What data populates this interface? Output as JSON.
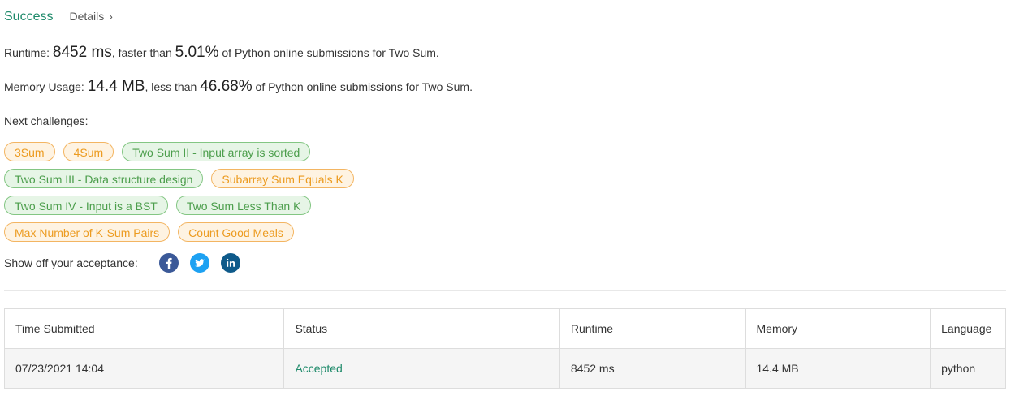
{
  "header": {
    "status": "Success",
    "details_label": "Details",
    "details_chevron": "›"
  },
  "runtime": {
    "label": "Runtime:",
    "value": "8452 ms",
    "mid": ", faster than",
    "percent": "5.01%",
    "tail": "of Python online submissions for Two Sum."
  },
  "memory": {
    "label": "Memory Usage:",
    "value": "14.4 MB",
    "mid": ", less than",
    "percent": "46.68%",
    "tail": "of Python online submissions for Two Sum."
  },
  "next_challenges": {
    "label": "Next challenges:",
    "items": [
      {
        "label": "3Sum",
        "difficulty": "medium"
      },
      {
        "label": "4Sum",
        "difficulty": "medium"
      },
      {
        "label": "Two Sum II - Input array is sorted",
        "difficulty": "easy"
      },
      {
        "label": "Two Sum III - Data structure design",
        "difficulty": "easy"
      },
      {
        "label": "Subarray Sum Equals K",
        "difficulty": "medium"
      },
      {
        "label": "Two Sum IV - Input is a BST",
        "difficulty": "easy"
      },
      {
        "label": "Two Sum Less Than K",
        "difficulty": "easy"
      },
      {
        "label": "Max Number of K-Sum Pairs",
        "difficulty": "medium"
      },
      {
        "label": "Count Good Meals",
        "difficulty": "medium"
      }
    ]
  },
  "share": {
    "label": "Show off your acceptance:",
    "icons": [
      {
        "name": "facebook-icon",
        "color": "#3b5998"
      },
      {
        "name": "twitter-icon",
        "color": "#1da1f2"
      },
      {
        "name": "linkedin-icon",
        "color": "#0e5a8a"
      }
    ]
  },
  "colors": {
    "accent": "#1e8a6a",
    "medium_text": "#ec9b20",
    "easy_text": "#4c9e4c"
  },
  "table": {
    "headers": [
      "Time Submitted",
      "Status",
      "Runtime",
      "Memory",
      "Language"
    ],
    "rows": [
      {
        "time": "07/23/2021 14:04",
        "status": "Accepted",
        "runtime": "8452 ms",
        "memory": "14.4 MB",
        "language": "python"
      }
    ]
  }
}
